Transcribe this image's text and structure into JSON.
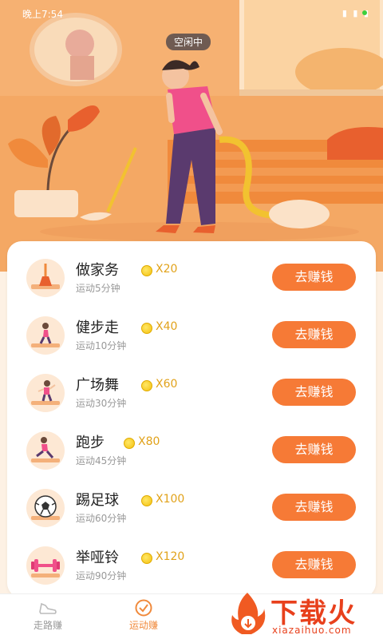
{
  "status_bar": {
    "time": "晚上7:54",
    "icons": "▮ ▮ ▮"
  },
  "hero": {
    "status_badge": "空闲中"
  },
  "tasks": [
    {
      "title": "做家务",
      "duration": "运动5分钟",
      "reward": "X20",
      "button": "去赚钱",
      "icon": "broom-icon"
    },
    {
      "title": "健步走",
      "duration": "运动10分钟",
      "reward": "X40",
      "button": "去赚钱",
      "icon": "walking-icon"
    },
    {
      "title": "广场舞",
      "duration": "运动30分钟",
      "reward": "X60",
      "button": "去赚钱",
      "icon": "dancing-icon"
    },
    {
      "title": "跑步",
      "duration": "运动45分钟",
      "reward": "X80",
      "button": "去赚钱",
      "icon": "running-icon"
    },
    {
      "title": "踢足球",
      "duration": "运动60分钟",
      "reward": "X100",
      "button": "去赚钱",
      "icon": "soccer-ball-icon"
    },
    {
      "title": "举哑铃",
      "duration": "运动90分钟",
      "reward": "X120",
      "button": "去赚钱",
      "icon": "dumbbell-icon"
    }
  ],
  "nav": [
    {
      "label": "走路赚",
      "icon": "shoe-icon",
      "active": false
    },
    {
      "label": "运动赚",
      "icon": "check-circle-icon",
      "active": true
    }
  ],
  "watermark": {
    "text": "下载火",
    "url": "xiazaihuo.com"
  },
  "colors": {
    "accent": "#f67a36",
    "reward": "#e1a21a",
    "hero_bg": "#f6b172"
  }
}
